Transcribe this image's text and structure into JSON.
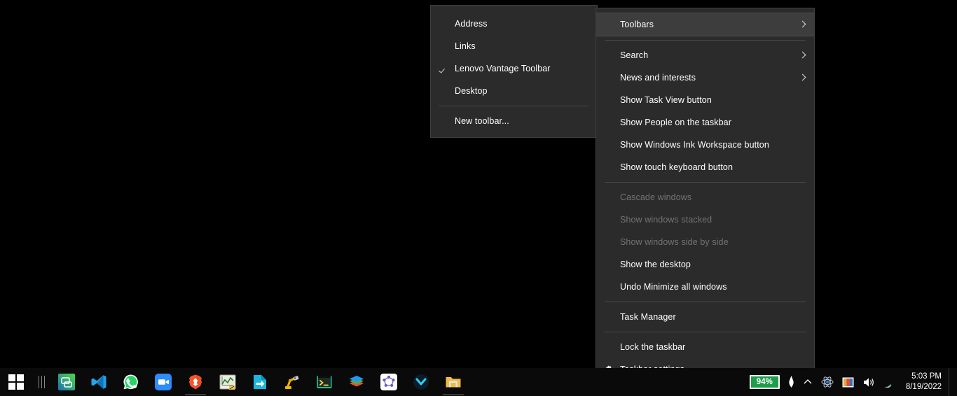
{
  "desktop": {
    "background_color": "#000000"
  },
  "main_menu": {
    "name": "taskbar-context-menu",
    "background_color": "#2b2b2b",
    "highlight_color": "#3d3d3d",
    "items": [
      {
        "label": "Toolbars",
        "submenu": true,
        "highlighted": true,
        "disabled": false,
        "icon": ""
      },
      {
        "separator": true
      },
      {
        "label": "Search",
        "submenu": true,
        "highlighted": false,
        "disabled": false,
        "icon": ""
      },
      {
        "label": "News and interests",
        "submenu": true,
        "highlighted": false,
        "disabled": false,
        "icon": ""
      },
      {
        "label": "Show Task View button",
        "submenu": false,
        "highlighted": false,
        "disabled": false,
        "icon": ""
      },
      {
        "label": "Show People on the taskbar",
        "submenu": false,
        "highlighted": false,
        "disabled": false,
        "icon": ""
      },
      {
        "label": "Show Windows Ink Workspace button",
        "submenu": false,
        "highlighted": false,
        "disabled": false,
        "icon": ""
      },
      {
        "label": "Show touch keyboard button",
        "submenu": false,
        "highlighted": false,
        "disabled": false,
        "icon": ""
      },
      {
        "separator": true
      },
      {
        "label": "Cascade windows",
        "submenu": false,
        "highlighted": false,
        "disabled": true,
        "icon": ""
      },
      {
        "label": "Show windows stacked",
        "submenu": false,
        "highlighted": false,
        "disabled": true,
        "icon": ""
      },
      {
        "label": "Show windows side by side",
        "submenu": false,
        "highlighted": false,
        "disabled": true,
        "icon": ""
      },
      {
        "label": "Show the desktop",
        "submenu": false,
        "highlighted": false,
        "disabled": false,
        "icon": ""
      },
      {
        "label": "Undo Minimize all windows",
        "submenu": false,
        "highlighted": false,
        "disabled": false,
        "icon": ""
      },
      {
        "separator": true
      },
      {
        "label": "Task Manager",
        "submenu": false,
        "highlighted": false,
        "disabled": false,
        "icon": ""
      },
      {
        "separator": true
      },
      {
        "label": "Lock the taskbar",
        "submenu": false,
        "highlighted": false,
        "disabled": false,
        "icon": ""
      },
      {
        "label": "Taskbar settings",
        "submenu": false,
        "highlighted": false,
        "disabled": false,
        "icon": "gear-icon"
      }
    ]
  },
  "toolbars_submenu": {
    "name": "toolbars-submenu",
    "items": [
      {
        "label": "Address",
        "checked": false
      },
      {
        "label": "Links",
        "checked": false
      },
      {
        "label": "Lenovo Vantage Toolbar",
        "checked": true
      },
      {
        "label": "Desktop",
        "checked": false
      },
      {
        "separator": true
      },
      {
        "label": "New toolbar...",
        "checked": false
      }
    ]
  },
  "taskbar": {
    "background_color": "#0a0a0a",
    "start_button": {
      "label": "Start",
      "icon": "windows-logo-icon"
    },
    "toolbar_grip": {
      "icon": "toolbar-grip-icon"
    },
    "apps": [
      {
        "name": "lenovo-vantage-toolbar",
        "label": "Lenovo Vantage Toolbar",
        "icon": "lenovo-vantage-icon",
        "running": false
      },
      {
        "name": "visual-studio-code",
        "label": "Visual Studio Code",
        "icon": "vscode-icon",
        "running": false
      },
      {
        "name": "whatsapp",
        "label": "WhatsApp",
        "icon": "whatsapp-icon",
        "running": false
      },
      {
        "name": "zoom",
        "label": "Zoom",
        "icon": "zoom-icon",
        "running": false
      },
      {
        "name": "brave-browser",
        "label": "Brave",
        "icon": "brave-icon",
        "running": true
      },
      {
        "name": "origin-lab",
        "label": "OriginLab",
        "icon": "originlab-icon",
        "running": false
      },
      {
        "name": "file-transfer",
        "label": "File Transfer",
        "icon": "file-transfer-icon",
        "running": false
      },
      {
        "name": "robot-studio",
        "label": "RobotStudio",
        "icon": "robot-icon",
        "running": false
      },
      {
        "name": "terminal-app",
        "label": "Terminal",
        "icon": "terminal-icon",
        "running": false
      },
      {
        "name": "layers-app",
        "label": "Layers",
        "icon": "layers-icon",
        "running": false
      },
      {
        "name": "geogebra",
        "label": "GeoGebra",
        "icon": "geogebra-icon",
        "running": false
      },
      {
        "name": "mailbird",
        "label": "Mailbird",
        "icon": "mail-icon",
        "running": false
      },
      {
        "name": "file-explorer",
        "label": "File Explorer",
        "icon": "folder-icon",
        "running": true
      }
    ],
    "tray": {
      "battery_percent": "94%",
      "pen_icon": "pen-icon",
      "show_hidden_icons": "chevron-up-icon",
      "atom_icon": "atom-icon",
      "display_icon": "display-icon",
      "volume_icon": "speaker-icon",
      "network_icon": "wifi-icon",
      "time": "5:03 PM",
      "date": "8/19/2022"
    }
  }
}
